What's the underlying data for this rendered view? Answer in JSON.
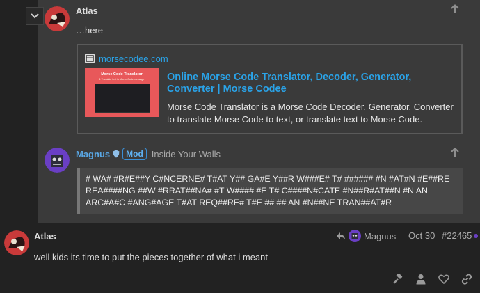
{
  "quote_post": {
    "author": "Atlas",
    "body": "…here",
    "onebox": {
      "domain": "morsecodee.com",
      "title": "Online Morse Code Translator, Decoder, Generator, Converter | Morse Codee",
      "description": "Morse Code Translator is a Morse Code Decoder, Generator, Converter to translate Morse Code to text, or translate text to Morse Code.",
      "thumb_title": "Morse Code Translator",
      "thumb_sub": "1 Translate text to Morse Code message"
    }
  },
  "reply_post": {
    "author": "Magnus",
    "badge": "Mod",
    "user_title": "Inside Your Walls",
    "quote_text": "# WA# #R#E##Y C#NCERNE# T#AT Y## GA#E Y##R W###E# T# ###### #N #AT#N #E##RE REA####NG ##W #RRAT##NA# #T W#### #E T# C####N#CATE #N##R#AT##N #N AN ARC#A#C #ANG#AGE T#AT REQ##RE# T#E ## ## AN #N##NE TRAN##AT#R"
  },
  "main_post": {
    "author": "Atlas",
    "reply_to": "Magnus",
    "date": "Oct 30",
    "post_number": "#22465",
    "body": "well kids its time to put the pieces together of what i meant"
  },
  "colors": {
    "accent": "#2aa3e8",
    "background": "#222222",
    "quote_bg": "#3a3a3a"
  },
  "icons": [
    "chevron-down-icon",
    "arrow-up-icon",
    "shield-icon",
    "reply-arrow-icon",
    "hammer-icon",
    "user-icon",
    "heart-icon",
    "link-icon"
  ]
}
